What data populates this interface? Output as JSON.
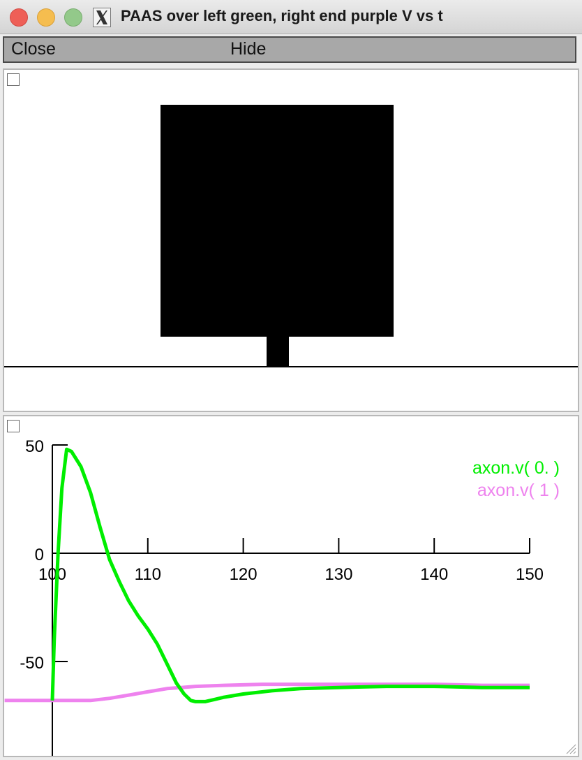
{
  "window": {
    "title": "PAAS over left green, right end purple V vs t",
    "icon": "x11-icon"
  },
  "menu": {
    "close_label": "Close",
    "hide_label": "Hide"
  },
  "shape_panel": {
    "checkbox_checked": false,
    "fill_color": "#000000"
  },
  "graph_panel": {
    "checkbox_checked": false
  },
  "chart_data": {
    "type": "line",
    "xlim": [
      100,
      150
    ],
    "ylim": [
      -80,
      50
    ],
    "x_ticks": [
      "100",
      "110",
      "120",
      "130",
      "140",
      "150"
    ],
    "y_ticks": [
      "50",
      "0",
      "-50"
    ],
    "legend_position": "top-right",
    "series": [
      {
        "name": "axon.v( 0. )",
        "color": "#00ee00",
        "points": [
          [
            100,
            -68
          ],
          [
            100.2,
            -40
          ],
          [
            100.6,
            0
          ],
          [
            101,
            30
          ],
          [
            101.5,
            48
          ],
          [
            102,
            47
          ],
          [
            103,
            40
          ],
          [
            104,
            28
          ],
          [
            105,
            12
          ],
          [
            106,
            -3
          ],
          [
            107,
            -13
          ],
          [
            108,
            -22
          ],
          [
            109,
            -29
          ],
          [
            110,
            -35
          ],
          [
            111,
            -42
          ],
          [
            112,
            -51
          ],
          [
            113,
            -60
          ],
          [
            113.8,
            -65
          ],
          [
            114.5,
            -68
          ],
          [
            115,
            -68.5
          ],
          [
            116,
            -68.5
          ],
          [
            117,
            -67.5
          ],
          [
            118,
            -66.5
          ],
          [
            120,
            -65
          ],
          [
            123,
            -63.5
          ],
          [
            126,
            -62.5
          ],
          [
            130,
            -62
          ],
          [
            135,
            -61.5
          ],
          [
            140,
            -61.5
          ],
          [
            145,
            -62
          ],
          [
            150,
            -62
          ]
        ]
      },
      {
        "name": "axon.v( 1 )",
        "color": "#ee82ee",
        "points": [
          [
            95,
            -68
          ],
          [
            100,
            -68
          ],
          [
            104,
            -68
          ],
          [
            106,
            -67
          ],
          [
            108,
            -65.5
          ],
          [
            110,
            -64
          ],
          [
            112,
            -62.5
          ],
          [
            113.5,
            -62
          ],
          [
            115,
            -61.5
          ],
          [
            118,
            -61
          ],
          [
            122,
            -60.5
          ],
          [
            128,
            -60.5
          ],
          [
            135,
            -60.5
          ],
          [
            140,
            -60.5
          ],
          [
            145,
            -61
          ],
          [
            150,
            -61
          ]
        ]
      }
    ]
  }
}
